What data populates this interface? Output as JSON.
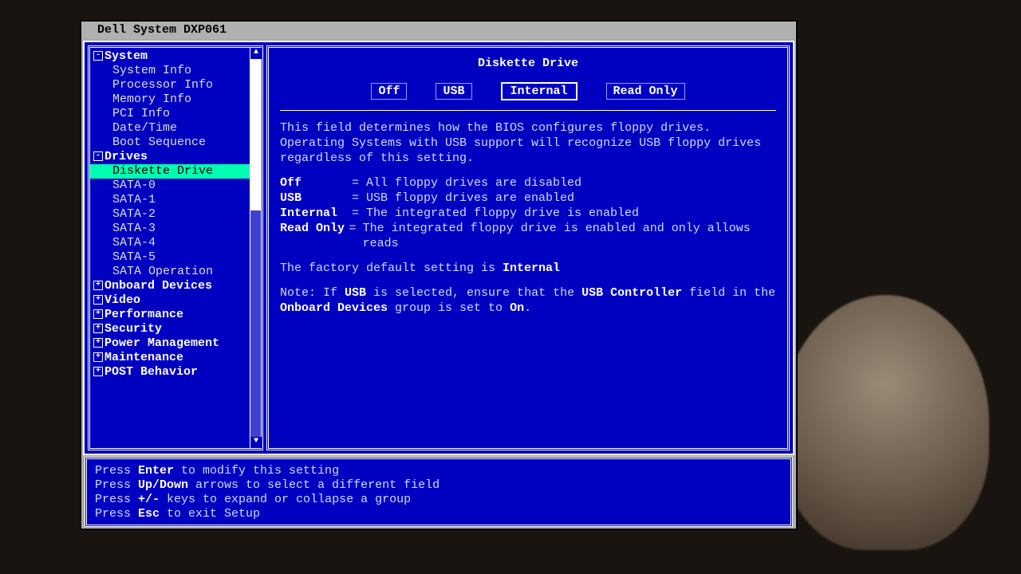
{
  "title": "Dell System DXP061",
  "nav": {
    "groups": [
      {
        "label": "System",
        "expanded": true,
        "items": [
          "System Info",
          "Processor Info",
          "Memory Info",
          "PCI Info",
          "Date/Time",
          "Boot Sequence"
        ]
      },
      {
        "label": "Drives",
        "expanded": true,
        "items": [
          "Diskette Drive",
          "SATA-0",
          "SATA-1",
          "SATA-2",
          "SATA-3",
          "SATA-4",
          "SATA-5",
          "SATA Operation"
        ],
        "selected": "Diskette Drive"
      },
      {
        "label": "Onboard Devices",
        "expanded": false
      },
      {
        "label": "Video",
        "expanded": false
      },
      {
        "label": "Performance",
        "expanded": false
      },
      {
        "label": "Security",
        "expanded": false
      },
      {
        "label": "Power Management",
        "expanded": false
      },
      {
        "label": "Maintenance",
        "expanded": false
      },
      {
        "label": "POST Behavior",
        "expanded": false
      }
    ]
  },
  "content": {
    "heading": "Diskette Drive",
    "options": [
      "Off",
      "USB",
      "Internal",
      "Read Only"
    ],
    "selected_option": "Internal",
    "intro": "This field determines how the BIOS configures floppy drives.  Operating Systems with USB support will recognize USB floppy drives regardless of this setting.",
    "defs": [
      {
        "k": "Off",
        "v": "All floppy drives are disabled"
      },
      {
        "k": "USB",
        "v": "USB floppy drives are enabled"
      },
      {
        "k": "Internal",
        "v": "The integrated floppy drive is enabled"
      },
      {
        "k": "Read Only",
        "v": "The integrated floppy drive is enabled and only allows reads"
      }
    ],
    "factory_prefix": "The factory default setting is ",
    "factory_value": "Internal",
    "note_prefix": "Note: If ",
    "note_usb": "USB",
    "note_mid1": " is selected, ensure that the ",
    "note_usbctrl": "USB Controller",
    "note_mid2": " field in the ",
    "note_onboard": "Onboard Devices",
    "note_mid3": " group is set to ",
    "note_on": "On",
    "note_end": "."
  },
  "footer": {
    "l1a": "Press ",
    "l1b": "Enter",
    "l1c": " to modify this setting",
    "l2a": "Press ",
    "l2b": "Up/Down",
    "l2c": " arrows to select a different field",
    "l3a": "Press ",
    "l3b": "+/-",
    "l3c": " keys to expand or collapse a group",
    "l4a": "Press ",
    "l4b": "Esc",
    "l4c": " to exit Setup"
  }
}
